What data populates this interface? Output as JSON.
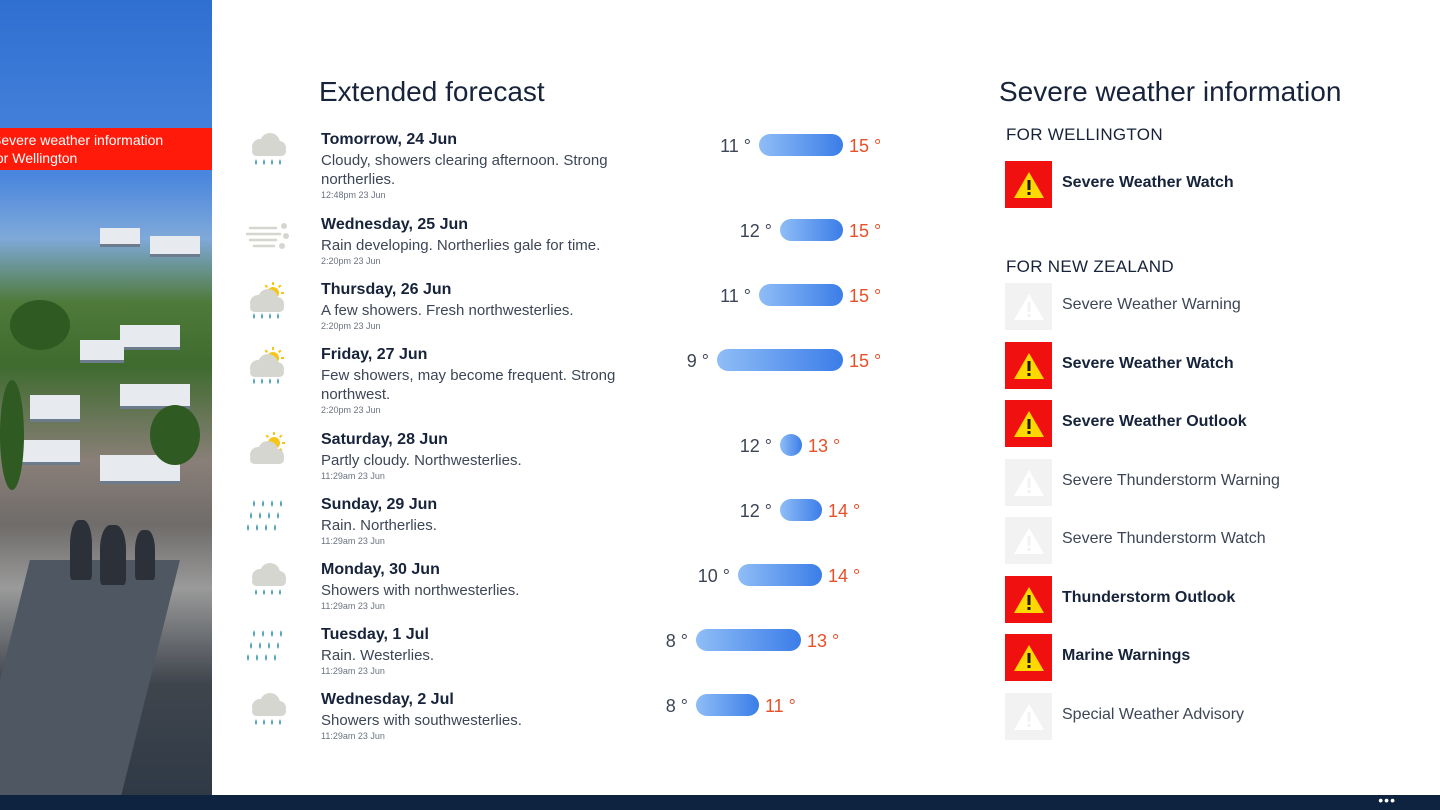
{
  "hero": {
    "banner_line1": "Severe weather information",
    "banner_line2": "for Wellington"
  },
  "forecast": {
    "title": "Extended forecast",
    "days": [
      {
        "day": "Tomorrow, 24 Jun",
        "desc": "Cloudy, showers clearing afternoon. Strong northerlies.",
        "stamp": "12:48pm 23 Jun",
        "low": "11 °",
        "high": "15 °",
        "icon": "cloud-rain-icon"
      },
      {
        "day": "Wednesday, 25 Jun",
        "desc": "Rain developing. Northerlies gale for time.",
        "stamp": "2:20pm 23 Jun",
        "low": "12 °",
        "high": "15 °",
        "icon": "wind-icon"
      },
      {
        "day": "Thursday, 26 Jun",
        "desc": "A few showers. Fresh northwesterlies.",
        "stamp": "2:20pm 23 Jun",
        "low": "11 °",
        "high": "15 °",
        "icon": "sun-cloud-rain-icon"
      },
      {
        "day": "Friday, 27 Jun",
        "desc": "Few showers, may become frequent. Strong northwest.",
        "stamp": "2:20pm 23 Jun",
        "low": "9 °",
        "high": "15 °",
        "icon": "sun-cloud-rain-icon"
      },
      {
        "day": "Saturday, 28 Jun",
        "desc": "Partly cloudy. Northwesterlies.",
        "stamp": "11:29am 23 Jun",
        "low": "12 °",
        "high": "13 °",
        "icon": "partly-cloudy-icon"
      },
      {
        "day": "Sunday, 29 Jun",
        "desc": "Rain. Northerlies.",
        "stamp": "11:29am 23 Jun",
        "low": "12 °",
        "high": "14 °",
        "icon": "rain-icon"
      },
      {
        "day": "Monday, 30 Jun",
        "desc": "Showers with northwesterlies.",
        "stamp": "11:29am 23 Jun",
        "low": "10 °",
        "high": "14 °",
        "icon": "cloud-rain-icon"
      },
      {
        "day": "Tuesday, 1 Jul",
        "desc": "Rain. Westerlies.",
        "stamp": "11:29am 23 Jun",
        "low": "8 °",
        "high": "13 °",
        "icon": "rain-icon"
      },
      {
        "day": "Wednesday, 2 Jul",
        "desc": "Showers with southwesterlies.",
        "stamp": "11:29am 23 Jun",
        "low": "8 °",
        "high": "11 °",
        "icon": "cloud-rain-icon"
      }
    ]
  },
  "severe": {
    "title": "Severe weather information",
    "wellington_heading": "FOR WELLINGTON",
    "wellington": [
      {
        "label": "Severe Weather Watch",
        "active": true
      }
    ],
    "nz_heading": "FOR NEW ZEALAND",
    "nz": [
      {
        "label": "Severe Weather Warning",
        "active": false
      },
      {
        "label": "Severe Weather Watch",
        "active": true
      },
      {
        "label": "Severe Weather Outlook",
        "active": true
      },
      {
        "label": "Severe Thunderstorm Warning",
        "active": false
      },
      {
        "label": "Severe Thunderstorm Watch",
        "active": false
      },
      {
        "label": "Thunderstorm Outlook",
        "active": true
      },
      {
        "label": "Marine Warnings",
        "active": true
      },
      {
        "label": "Special Weather Advisory",
        "active": false
      }
    ]
  },
  "appbar": {
    "more_label": "•••"
  },
  "colors": {
    "alert_red": "#f01010",
    "warning_yellow": "#ffd800",
    "high_temp": "#e8502a",
    "bar_blue": "#3b7de8",
    "appbar": "#0e2340",
    "banner_red": "#ff1a0a"
  }
}
